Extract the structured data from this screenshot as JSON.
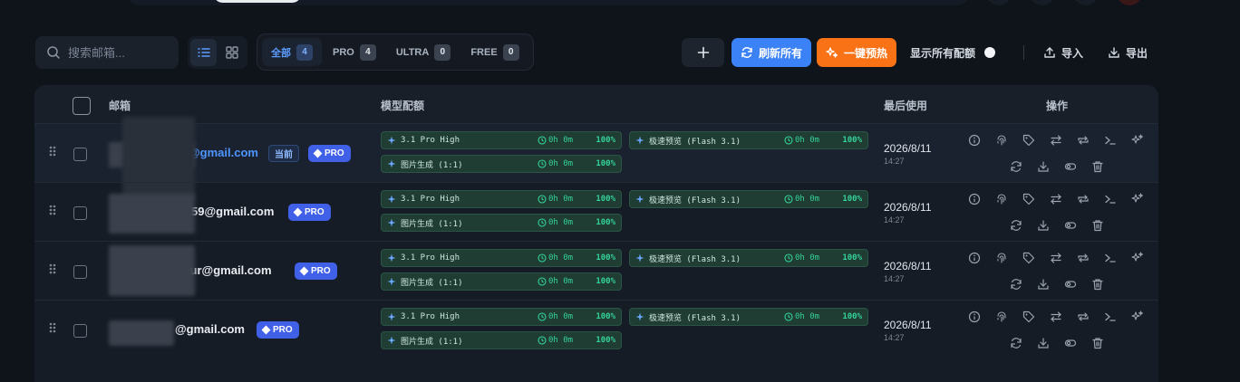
{
  "toolbar": {
    "search_placeholder": "搜索邮箱...",
    "filters": [
      {
        "label": "全部",
        "count": "4"
      },
      {
        "label": "PRO",
        "count": "4"
      },
      {
        "label": "ULTRA",
        "count": "0"
      },
      {
        "label": "FREE",
        "count": "0"
      }
    ],
    "add_label": "+",
    "refresh_label": "刷新所有",
    "preheat_label": "一键预热",
    "show_quota_label": "显示所有配额",
    "show_quota_on": false,
    "import_label": "导入",
    "export_label": "导出"
  },
  "table": {
    "headers": {
      "email": "邮箱",
      "quota": "模型配额",
      "last_used": "最后使用",
      "actions": "操作"
    },
    "rows": [
      {
        "email": "@gmail.com",
        "current_label": "当前",
        "tier": "PRO",
        "quotas": [
          {
            "name": "3.1 Pro High",
            "time": "0h 0m",
            "pct": "100%"
          },
          {
            "name": "极速预览 (Flash 3.1)",
            "time": "0h 0m",
            "pct": "100%"
          },
          {
            "name": "图片生成 (1:1)",
            "time": "0h 0m",
            "pct": "100%"
          }
        ],
        "date": "2026/8/11",
        "time": "14:27"
      },
      {
        "email": "59@gmail.com",
        "current_label": "",
        "tier": "PRO",
        "quotas": [
          {
            "name": "3.1 Pro High",
            "time": "0h 0m",
            "pct": "100%"
          },
          {
            "name": "极速预览 (Flash 3.1)",
            "time": "0h 0m",
            "pct": "100%"
          },
          {
            "name": "图片生成 (1:1)",
            "time": "0h 0m",
            "pct": "100%"
          }
        ],
        "date": "2026/8/11",
        "time": "14:27"
      },
      {
        "email": "ipur@gmail.com",
        "current_label": "",
        "tier": "PRO",
        "quotas": [
          {
            "name": "3.1 Pro High",
            "time": "0h 0m",
            "pct": "100%"
          },
          {
            "name": "极速预览 (Flash 3.1)",
            "time": "0h 0m",
            "pct": "100%"
          },
          {
            "name": "图片生成 (1:1)",
            "time": "0h 0m",
            "pct": "100%"
          }
        ],
        "date": "2026/8/11",
        "time": "14:27"
      },
      {
        "email": "@gmail.com",
        "current_label": "",
        "tier": "PRO",
        "quotas": [
          {
            "name": "3.1 Pro High",
            "time": "0h 0m",
            "pct": "100%"
          },
          {
            "name": "极速预览 (Flash 3.1)",
            "time": "0h 0m",
            "pct": "100%"
          },
          {
            "name": "图片生成 (1:1)",
            "time": "0h 0m",
            "pct": "100%"
          }
        ],
        "date": "2026/8/11",
        "time": "14:27"
      }
    ]
  },
  "icons": {
    "actions_top": [
      "info-icon",
      "fingerprint-icon",
      "tag-icon",
      "switch-icon",
      "repeat-icon",
      "terminal-icon",
      "sparkles-icon"
    ],
    "actions_bottom": [
      "refresh-icon",
      "download-icon",
      "toggle-icon",
      "trash-icon"
    ]
  },
  "colors": {
    "accent_blue": "#3b82f6",
    "accent_orange": "#f97316",
    "pro_badge": "#4060e8",
    "quota_green": "#34d399"
  }
}
